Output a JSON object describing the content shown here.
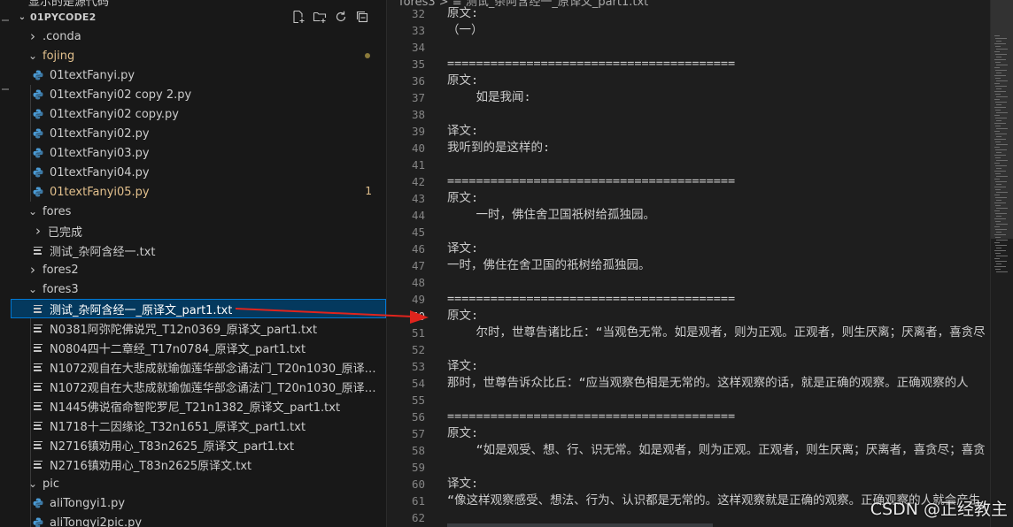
{
  "sidebar": {
    "top_crumb": "显示的是源代码",
    "section_title": "01PYCODE2",
    "section_actions": [
      "new-file-icon",
      "new-folder-icon",
      "refresh-icon",
      "collapse-all-icon"
    ],
    "items": [
      {
        "label": ".conda",
        "kind": "folder",
        "open": false,
        "depth": 0
      },
      {
        "label": "fojing",
        "kind": "folder",
        "open": true,
        "depth": 0,
        "modified": true
      },
      {
        "label": "01textFanyi.py",
        "kind": "py",
        "depth": 1
      },
      {
        "label": "01textFanyi02 copy 2.py",
        "kind": "py",
        "depth": 1
      },
      {
        "label": "01textFanyi02 copy.py",
        "kind": "py",
        "depth": 1
      },
      {
        "label": "01textFanyi02.py",
        "kind": "py",
        "depth": 1
      },
      {
        "label": "01textFanyi03.py",
        "kind": "py",
        "depth": 1
      },
      {
        "label": "01textFanyi04.py",
        "kind": "py",
        "depth": 1
      },
      {
        "label": "01textFanyi05.py",
        "kind": "py",
        "depth": 1,
        "modified": true,
        "badge": "1"
      },
      {
        "label": "fores",
        "kind": "folder",
        "open": true,
        "depth": 0
      },
      {
        "label": "已完成",
        "kind": "folder",
        "open": false,
        "depth": 1
      },
      {
        "label": "测试_杂阿含经一.txt",
        "kind": "txt",
        "depth": 1
      },
      {
        "label": "fores2",
        "kind": "folder",
        "open": false,
        "depth": 0
      },
      {
        "label": "fores3",
        "kind": "folder",
        "open": true,
        "depth": 0
      },
      {
        "label": "测试_杂阿含经一_原译文_part1.txt",
        "kind": "txt",
        "depth": 1,
        "selected": true
      },
      {
        "label": "N0381阿弥陀佛说咒_T12n0369_原译文_part1.txt",
        "kind": "txt",
        "depth": 1
      },
      {
        "label": "N0804四十二章经_T17n0784_原译文_part1.txt",
        "kind": "txt",
        "depth": 1
      },
      {
        "label": "N1072观自在大悲成就瑜伽莲华部念诵法门_T20n1030_原译文_pa...",
        "kind": "txt",
        "depth": 1
      },
      {
        "label": "N1072观自在大悲成就瑜伽莲华部念诵法门_T20n1030_原译文_part...",
        "kind": "txt",
        "depth": 1
      },
      {
        "label": "N1445佛说宿命智陀罗尼_T21n1382_原译文_part1.txt",
        "kind": "txt",
        "depth": 1
      },
      {
        "label": "N1718十二因缘论_T32n1651_原译文_part1.txt",
        "kind": "txt",
        "depth": 1
      },
      {
        "label": "N2716镇劝用心_T83n2625_原译文_part1.txt",
        "kind": "txt",
        "depth": 1
      },
      {
        "label": "N2716镇劝用心_T83n2625原译文.txt",
        "kind": "txt",
        "depth": 1
      },
      {
        "label": "pic",
        "kind": "folder",
        "open": true,
        "depth": 0
      },
      {
        "label": "aliTongyi1.py",
        "kind": "py",
        "depth": 1
      },
      {
        "label": "aliTongyi2pic.py",
        "kind": "py",
        "depth": 1
      }
    ]
  },
  "editor": {
    "breadcrumb": "fores3 > ≡ 测试_杂阿含经一_原译文_part1.txt",
    "current_line": "50",
    "lines": [
      {
        "n": "32",
        "text": "原文:"
      },
      {
        "n": "33",
        "text": "（一）"
      },
      {
        "n": "34",
        "text": ""
      },
      {
        "n": "35",
        "text": "========================================"
      },
      {
        "n": "36",
        "text": "原文:"
      },
      {
        "n": "37",
        "text": "    如是我闻:"
      },
      {
        "n": "38",
        "text": ""
      },
      {
        "n": "39",
        "text": "译文:"
      },
      {
        "n": "40",
        "text": "我听到的是这样的:"
      },
      {
        "n": "41",
        "text": ""
      },
      {
        "n": "42",
        "text": "========================================"
      },
      {
        "n": "43",
        "text": "原文:"
      },
      {
        "n": "44",
        "text": "    一时，佛住舍卫国祇树给孤独园。"
      },
      {
        "n": "45",
        "text": ""
      },
      {
        "n": "46",
        "text": "译文:"
      },
      {
        "n": "47",
        "text": "一时，佛住在舍卫国的祇树给孤独园。"
      },
      {
        "n": "48",
        "text": ""
      },
      {
        "n": "49",
        "text": "========================================"
      },
      {
        "n": "50",
        "text": "原文:"
      },
      {
        "n": "51",
        "text": "    尔时，世尊告诸比丘：“当观色无常。如是观者，则为正观。正观者，则生厌离；厌离者，喜贪尽"
      },
      {
        "n": "52",
        "text": ""
      },
      {
        "n": "53",
        "text": "译文:"
      },
      {
        "n": "54",
        "text": "那时，世尊告诉众比丘：“应当观察色相是无常的。这样观察的话，就是正确的观察。正确观察的人"
      },
      {
        "n": "55",
        "text": ""
      },
      {
        "n": "56",
        "text": "========================================"
      },
      {
        "n": "57",
        "text": "原文:"
      },
      {
        "n": "58",
        "text": "    “如是观受、想、行、识无常。如是观者，则为正观。正观者，则生厌离；厌离者，喜贪尽；喜贪"
      },
      {
        "n": "59",
        "text": ""
      },
      {
        "n": "60",
        "text": "译文:"
      },
      {
        "n": "61",
        "text": "“像这样观察感受、想法、行为、认识都是无常的。这样观察就是正确的观察。正确观察的人就会产生"
      },
      {
        "n": "62",
        "text": ""
      },
      {
        "n": "63",
        "text": "========================================"
      }
    ]
  },
  "watermark": "CSDN @正经教主",
  "colors": {
    "selection_bg": "#04395e",
    "selection_border": "#0078d4",
    "modified_text": "#e2c08d",
    "python_icon": "#4a9ad4",
    "arrow": "#e0241d"
  }
}
